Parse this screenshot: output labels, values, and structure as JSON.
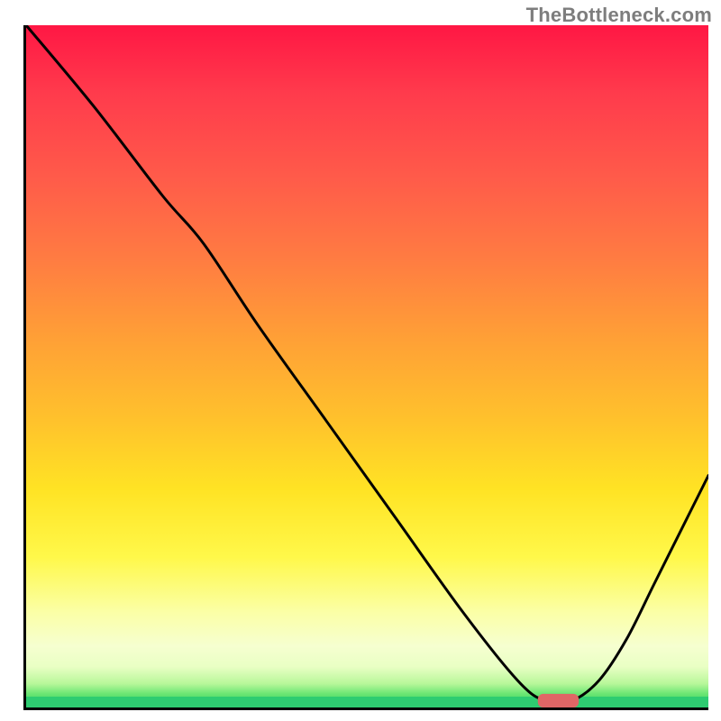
{
  "watermark": "TheBottleneck.com",
  "chart_data": {
    "type": "line",
    "title": "",
    "xlabel": "",
    "ylabel": "",
    "xlim": [
      0,
      100
    ],
    "ylim": [
      0,
      100
    ],
    "grid": false,
    "legend": false,
    "background": {
      "type": "vertical_gradient",
      "stops": [
        {
          "pos": 0,
          "color": "#ff1744"
        },
        {
          "pos": 22,
          "color": "#ff5a4a"
        },
        {
          "pos": 46,
          "color": "#ffa036"
        },
        {
          "pos": 68,
          "color": "#ffe324"
        },
        {
          "pos": 86,
          "color": "#fbffa6"
        },
        {
          "pos": 96,
          "color": "#b8f79a"
        },
        {
          "pos": 100,
          "color": "#2ecc71"
        }
      ],
      "green_strip_height_pct": 1.6
    },
    "series": [
      {
        "name": "bottleneck_curve",
        "x": [
          0,
          10,
          20,
          26,
          34,
          44,
          54,
          64,
          72,
          76,
          80,
          84,
          88,
          92,
          96,
          100
        ],
        "y": [
          100,
          88,
          75,
          68,
          56,
          42,
          28,
          14,
          4,
          1,
          1,
          4,
          10,
          18,
          26,
          34
        ]
      }
    ],
    "marker": {
      "shape": "rounded_rect",
      "x_center": 78,
      "y_center": 1,
      "width": 6,
      "height": 2,
      "color": "#e06666"
    }
  }
}
